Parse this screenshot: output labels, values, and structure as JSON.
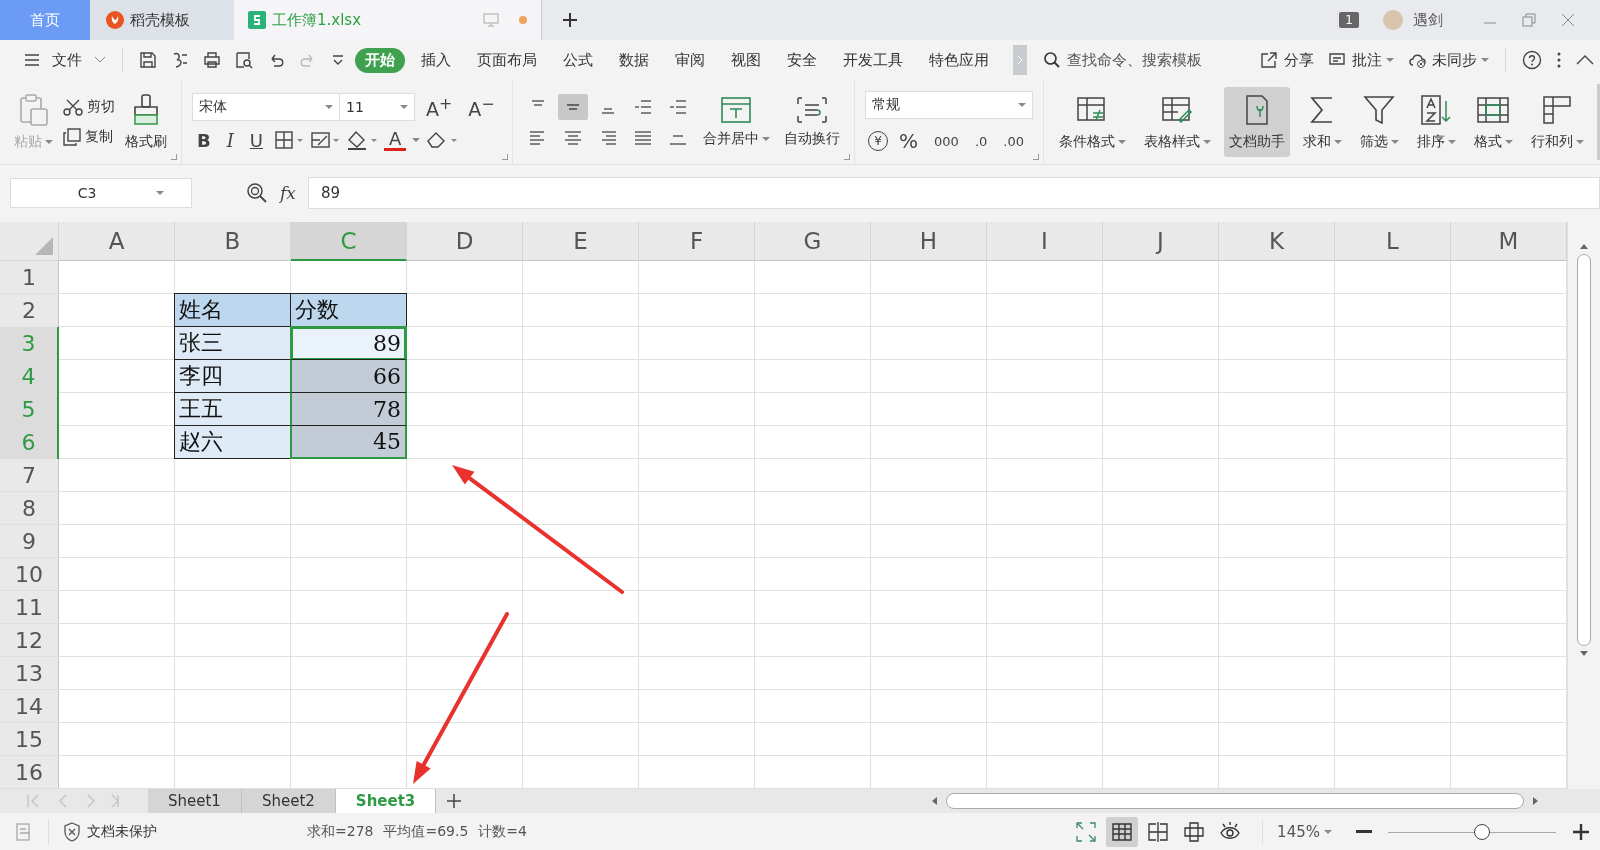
{
  "window_tabs": [
    {
      "label": "首页",
      "kind": "home",
      "selected": false
    },
    {
      "label": "稻壳模板",
      "kind": "docer",
      "selected": false
    },
    {
      "label": "工作簿1.xlsx",
      "kind": "workbook",
      "selected": true,
      "unsaved": true
    }
  ],
  "account": {
    "badge": "1",
    "name": "遇剑"
  },
  "file_menu": "文件",
  "ribbon_tabs": [
    {
      "label": "开始",
      "selected": true
    },
    {
      "label": "插入",
      "selected": false
    },
    {
      "label": "页面布局",
      "selected": false
    },
    {
      "label": "公式",
      "selected": false
    },
    {
      "label": "数据",
      "selected": false
    },
    {
      "label": "审阅",
      "selected": false
    },
    {
      "label": "视图",
      "selected": false
    },
    {
      "label": "安全",
      "selected": false
    },
    {
      "label": "开发工具",
      "selected": false
    },
    {
      "label": "特色应用",
      "selected": false
    }
  ],
  "search": {
    "placeholder": "查找命令、搜索模板"
  },
  "actions": [
    {
      "label": "分享",
      "kind": "share",
      "dropdown": false
    },
    {
      "label": "批注",
      "kind": "comment",
      "dropdown": true
    },
    {
      "label": "未同步",
      "kind": "sync",
      "dropdown": true
    }
  ],
  "clipboard": {
    "paste": {
      "label": "粘贴",
      "disabled": true
    },
    "cut": "剪切",
    "copy": "复制",
    "format_painter": "格式刷"
  },
  "font": {
    "name": "宋体",
    "size": "11",
    "grow": "A$^{+}$",
    "shrink": "A$^{−}$",
    "color_button": "A",
    "styles": [
      {
        "label": "B",
        "kind": "bold"
      },
      {
        "label": "I",
        "kind": "italic"
      },
      {
        "label": "U",
        "kind": "underline"
      }
    ]
  },
  "alignment": {
    "buttons": [
      {
        "kind": "top",
        "selected": false
      },
      {
        "kind": "middle",
        "selected": true
      },
      {
        "kind": "bottom",
        "selected": false
      },
      {
        "kind": "outdent",
        "selected": false
      },
      {
        "kind": "indent",
        "selected": false
      },
      {
        "kind": "left",
        "selected": false
      },
      {
        "kind": "center",
        "selected": false
      },
      {
        "kind": "right",
        "selected": false
      },
      {
        "kind": "justify",
        "selected": false
      },
      {
        "kind": "distributed",
        "selected": false
      }
    ],
    "merge": "合并居中",
    "wrap": "自动换行"
  },
  "number": {
    "format": "常规",
    "buttons": [
      {
        "kind": "currency",
        "label": "¥"
      },
      {
        "kind": "percent",
        "label": "%"
      },
      {
        "kind": "thousands",
        "label": "000"
      },
      {
        "kind": "increase-decimal",
        "label": ".0"
      },
      {
        "kind": "decrease-decimal",
        "label": ".00"
      }
    ]
  },
  "commands": [
    {
      "label": "条件格式",
      "kind": "conditional",
      "selected": false,
      "dropdown": true
    },
    {
      "label": "表格样式",
      "kind": "table-style",
      "selected": false,
      "dropdown": true
    },
    {
      "label": "文档助手",
      "kind": "assistant",
      "selected": true,
      "dropdown": false
    },
    {
      "label": "求和",
      "kind": "sum",
      "selected": false,
      "dropdown": true
    },
    {
      "label": "筛选",
      "kind": "filter",
      "selected": false,
      "dropdown": true
    },
    {
      "label": "排序",
      "kind": "sort",
      "selected": false,
      "dropdown": true
    },
    {
      "label": "格式",
      "kind": "format",
      "selected": false,
      "dropdown": true
    },
    {
      "label": "行和列",
      "kind": "rows-cols",
      "selected": false,
      "dropdown": true
    }
  ],
  "name_box": "C3",
  "fx": "fx",
  "formula": "89",
  "columns": [
    {
      "label": "A",
      "selected": false
    },
    {
      "label": "B",
      "selected": false
    },
    {
      "label": "C",
      "selected": true
    },
    {
      "label": "D",
      "selected": false
    },
    {
      "label": "E",
      "selected": false
    },
    {
      "label": "F",
      "selected": false
    },
    {
      "label": "G",
      "selected": false
    },
    {
      "label": "H",
      "selected": false
    },
    {
      "label": "I",
      "selected": false
    },
    {
      "label": "J",
      "selected": false
    },
    {
      "label": "K",
      "selected": false
    },
    {
      "label": "L",
      "selected": false
    },
    {
      "label": "M",
      "selected": false
    }
  ],
  "rows": [
    {
      "number": "1",
      "selected": false
    },
    {
      "number": "2",
      "selected": false,
      "cells": [
        {
          "kind": "empty"
        },
        {
          "kind": "header",
          "text": "姓名",
          "selected": false,
          "active": false
        },
        {
          "kind": "header",
          "text": "分数",
          "selected": false,
          "active": false
        }
      ]
    },
    {
      "number": "3",
      "selected": true,
      "cells": [
        {
          "kind": "empty"
        },
        {
          "kind": "label",
          "text": "张三",
          "selected": false,
          "active": false
        },
        {
          "kind": "number",
          "text": "89",
          "selected": true,
          "active": true
        }
      ]
    },
    {
      "number": "4",
      "selected": true,
      "cells": [
        {
          "kind": "empty"
        },
        {
          "kind": "label",
          "text": "李四",
          "selected": false,
          "active": false
        },
        {
          "kind": "number",
          "text": "66",
          "selected": true,
          "active": false
        }
      ]
    },
    {
      "number": "5",
      "selected": true,
      "cells": [
        {
          "kind": "empty"
        },
        {
          "kind": "label",
          "text": "王五",
          "selected": false,
          "active": false
        },
        {
          "kind": "number",
          "text": "78",
          "selected": true,
          "active": false
        }
      ]
    },
    {
      "number": "6",
      "selected": true,
      "cells": [
        {
          "kind": "empty"
        },
        {
          "kind": "label",
          "text": "赵六",
          "selected": false,
          "active": false
        },
        {
          "kind": "number",
          "text": "45",
          "selected": true,
          "active": false
        }
      ]
    },
    {
      "number": "7",
      "selected": false
    },
    {
      "number": "8",
      "selected": false
    },
    {
      "number": "9",
      "selected": false
    },
    {
      "number": "10",
      "selected": false
    },
    {
      "number": "11",
      "selected": false
    },
    {
      "number": "12",
      "selected": false
    },
    {
      "number": "13",
      "selected": false
    },
    {
      "number": "14",
      "selected": false
    },
    {
      "number": "15",
      "selected": false
    },
    {
      "number": "16",
      "selected": false
    }
  ],
  "sheets": [
    {
      "label": "Sheet1",
      "selected": false
    },
    {
      "label": "Sheet2",
      "selected": false
    },
    {
      "label": "Sheet3",
      "selected": true
    }
  ],
  "annotations": [
    {
      "kind": "arrow"
    },
    {
      "kind": "arrow"
    }
  ],
  "status": {
    "protection": "文档未保护",
    "stats": [
      "求和=278",
      "平均值=69.5",
      "计数=4"
    ],
    "zoom": "145%",
    "zoom_level": {
      "level": 0.56
    },
    "views": [
      {
        "kind": "fullscreen",
        "selected": false
      },
      {
        "kind": "normal",
        "selected": true
      },
      {
        "kind": "page-break",
        "selected": false
      },
      {
        "kind": "reading",
        "selected": false
      },
      {
        "kind": "eye-care",
        "selected": false
      }
    ]
  }
}
